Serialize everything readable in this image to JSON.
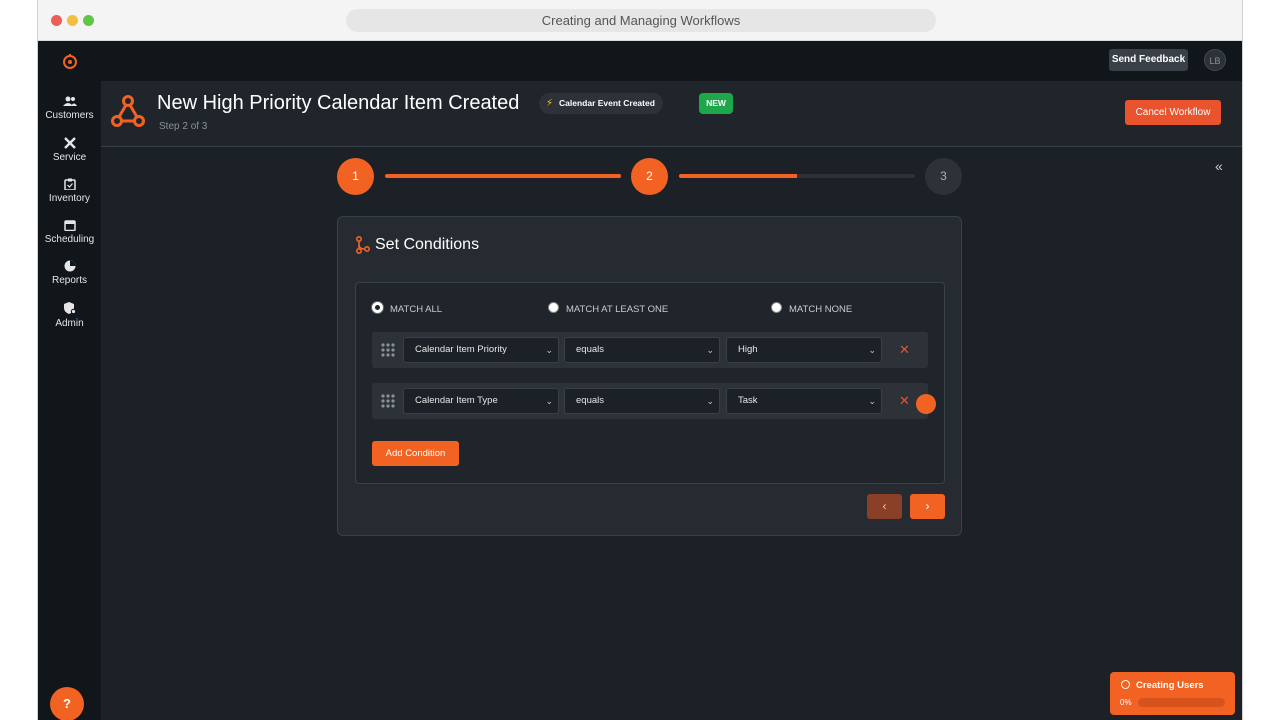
{
  "browser": {
    "title": "Creating and Managing Workflows"
  },
  "topbar": {
    "feedback_label": "Send Feedback",
    "avatar_initials": "LB"
  },
  "sidebar": {
    "items": [
      {
        "label": "Customers",
        "icon": "users-icon"
      },
      {
        "label": "Service",
        "icon": "tools-icon"
      },
      {
        "label": "Inventory",
        "icon": "clipboard-icon"
      },
      {
        "label": "Scheduling",
        "icon": "calendar-icon"
      },
      {
        "label": "Reports",
        "icon": "pie-chart-icon"
      },
      {
        "label": "Admin",
        "icon": "shield-gear-icon"
      }
    ],
    "help_label": "?"
  },
  "header": {
    "title": "New High Priority Calendar Item Created",
    "step_text": "Step 2 of 3",
    "trigger_badge": "Calendar Event Created",
    "new_badge": "NEW",
    "cancel_label": "Cancel Workflow"
  },
  "stepper": {
    "steps": [
      "1",
      "2",
      "3"
    ],
    "current": 2,
    "progress_1_to_2": 1.0,
    "progress_2_to_3": 0.5,
    "collapse_icon": "«"
  },
  "conditions": {
    "title": "Set Conditions",
    "match_options": [
      "MATCH ALL",
      "MATCH AT LEAST ONE",
      "MATCH NONE"
    ],
    "match_selected": "MATCH ALL",
    "rows": [
      {
        "field": "Calendar Item Priority",
        "operator": "equals",
        "value": "High"
      },
      {
        "field": "Calendar Item Type",
        "operator": "equals",
        "value": "Task"
      }
    ],
    "add_label": "Add Condition",
    "prev_icon": "‹",
    "next_icon": "›"
  },
  "toast": {
    "title": "Creating Users",
    "percent_text": "0%",
    "progress": 0
  },
  "colors": {
    "accent": "#f26323",
    "danger": "#e9532e",
    "success": "#1ea64b",
    "background": "#1b2127"
  }
}
